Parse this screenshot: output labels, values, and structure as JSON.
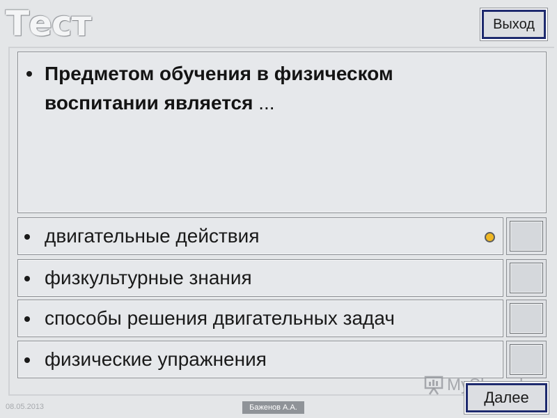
{
  "header": {
    "title": "Тест",
    "exit_label": "Выход"
  },
  "question": {
    "text": "Предметом обучения в физическом воспитании является",
    "ellipsis": " ..."
  },
  "answers": [
    {
      "text": "двигательные действия"
    },
    {
      "text": "физкультурные знания"
    },
    {
      "text": "способы решения двигательных задач"
    },
    {
      "text": "физические упражнения"
    }
  ],
  "footer": {
    "date": "08.05.2013",
    "author": "Баженов А.А.",
    "next_label": "Далее",
    "watermark": "MyShared"
  },
  "icons": {
    "selection": "radio-dot-icon",
    "watermark": "presentation-board-icon"
  },
  "colors": {
    "button_border": "#1e2a6e",
    "selection_dot": "#f0b823",
    "panel_bg": "#e6e8eb"
  }
}
